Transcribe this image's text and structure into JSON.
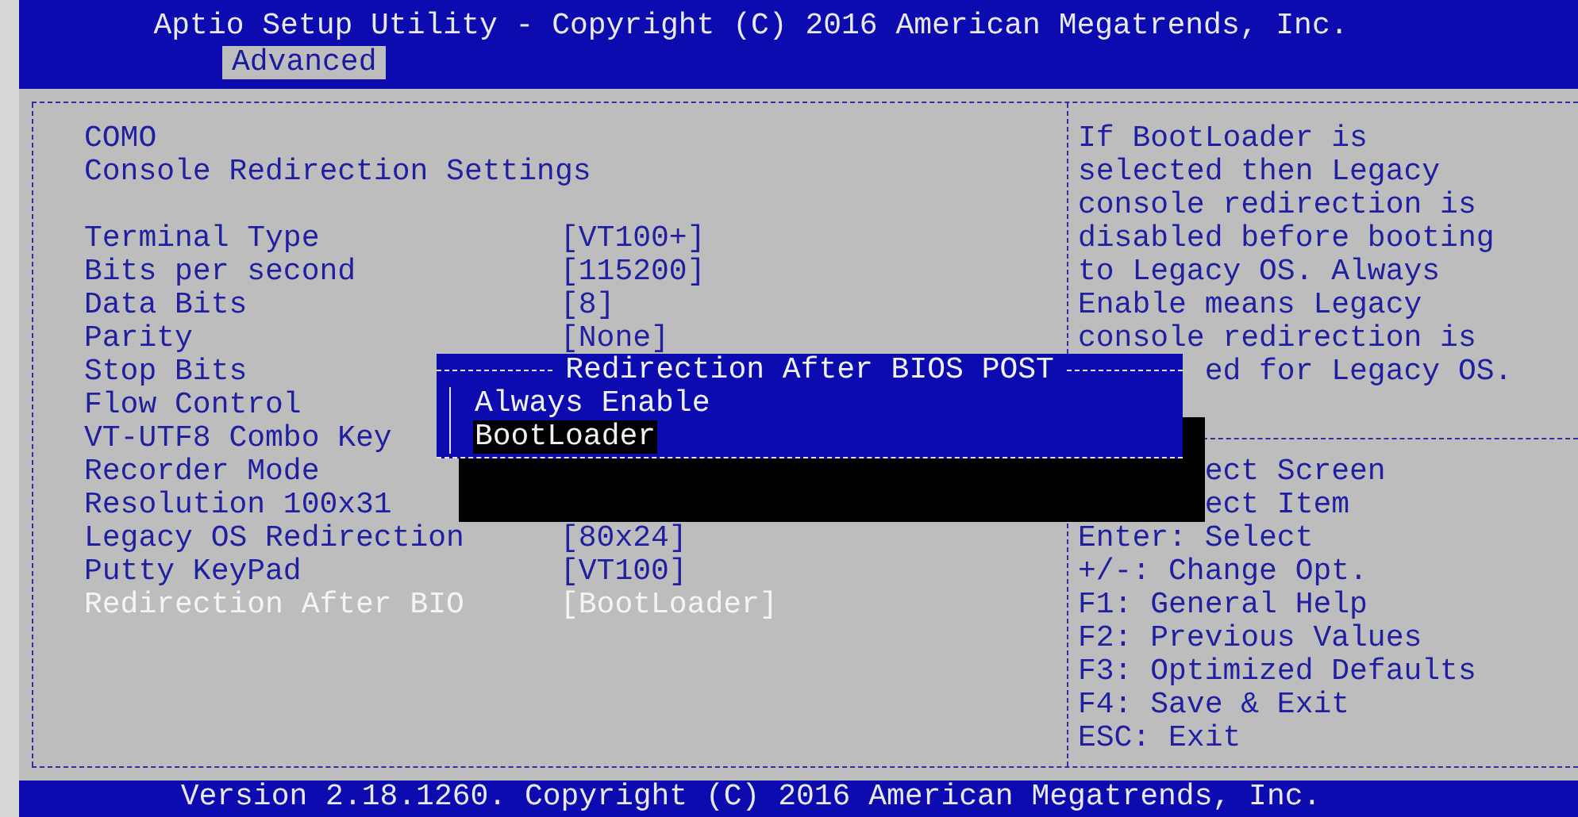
{
  "window": {
    "title": "Aptio Setup Utility - Copyright (C) 2016 American Megatrends, Inc."
  },
  "tabs": [
    {
      "label": "Advanced",
      "selected": true
    }
  ],
  "heading": [
    "COMO",
    "Console Redirection Settings"
  ],
  "settings": [
    {
      "label": "Terminal Type",
      "value": "[VT100+]",
      "selected": false
    },
    {
      "label": "Bits per second",
      "value": "[115200]",
      "selected": false
    },
    {
      "label": "Data Bits",
      "value": "[8]",
      "selected": false
    },
    {
      "label": "Parity",
      "value": "[None]",
      "selected": false
    },
    {
      "label": "Stop Bits",
      "selected": false
    },
    {
      "label": "Flow Control",
      "selected": false
    },
    {
      "label": "VT-UTF8 Combo Key",
      "selected": false
    },
    {
      "label": "Recorder Mode",
      "selected": false
    },
    {
      "label": "Resolution 100x31",
      "selected": false
    },
    {
      "label": "Legacy OS Redirection",
      "value": "[80x24]",
      "selected": false
    },
    {
      "label": "Putty KeyPad",
      "value": "[VT100]",
      "selected": false
    },
    {
      "label": "Redirection After BIO",
      "value": "[BootLoader]",
      "selected": true
    }
  ],
  "help": [
    {
      "text": "If BootLoader is",
      "kind": "full"
    },
    {
      "text": "selected then Legacy",
      "kind": "full"
    },
    {
      "text": "console redirection is",
      "kind": "full"
    },
    {
      "text": "disabled before booting",
      "kind": "full"
    },
    {
      "text": "to Legacy OS. Always",
      "kind": "full"
    },
    {
      "text": "Enable means Legacy",
      "kind": "full"
    },
    {
      "text": "console redirection is",
      "kind": "full"
    },
    {
      "text": "ed for Legacy OS.",
      "kind": "covered"
    }
  ],
  "keys": [
    {
      "text": "ect Screen",
      "kind": "covered"
    },
    {
      "text": "ect Item",
      "kind": "covered"
    },
    {
      "text": "Enter: Select",
      "kind": "full"
    },
    {
      "text": "+/-: Change Opt.",
      "kind": "full"
    },
    {
      "text": "F1: General Help",
      "kind": "full"
    },
    {
      "text": "F2: Previous Values",
      "kind": "full"
    },
    {
      "text": "F3: Optimized Defaults",
      "kind": "full"
    },
    {
      "text": "F4: Save & Exit",
      "kind": "full"
    },
    {
      "text": "ESC: Exit",
      "kind": "full"
    }
  ],
  "popup": {
    "title": "Redirection After BIOS POST",
    "options": [
      {
        "label": "Always Enable",
        "selected": false
      },
      {
        "label": "BootLoader",
        "selected": true
      }
    ]
  },
  "status_bar": "Version 2.18.1260. Copyright (C) 2016 American Megatrends, Inc."
}
